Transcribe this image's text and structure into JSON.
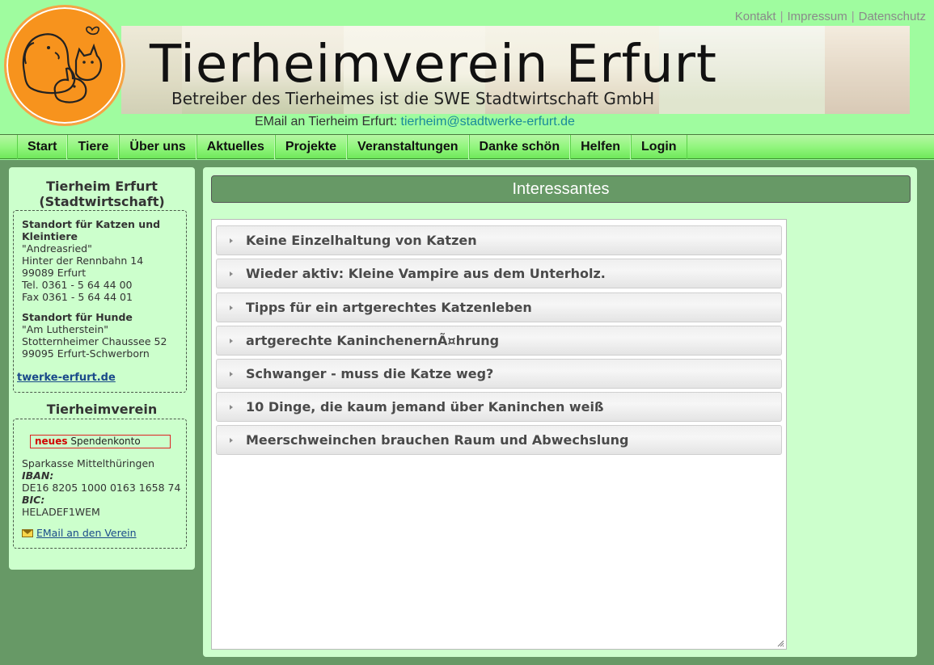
{
  "top_links": [
    "Kontakt",
    "Impressum",
    "Datenschutz"
  ],
  "header": {
    "title": "Tierheimverein Erfurt",
    "subtitle": "Betreiber des Tierheimes ist die SWE Stadtwirtschaft GmbH",
    "email_label": "EMail an Tierheim Erfurt:",
    "email_address": "tierheim@stadtwerke-erfurt.de"
  },
  "nav": [
    "Start",
    "Tiere",
    "Über uns",
    "Aktuelles",
    "Projekte",
    "Veranstaltungen",
    "Danke schön",
    "Helfen",
    "Login"
  ],
  "sidebar": {
    "title1_line1": "Tierheim Erfurt",
    "title1_line2": "(Stadtwirtschaft)",
    "cats_heading": "Standort für Katzen und Kleintiere",
    "cats_lines": [
      "\"Andreasried\"",
      "Hinter der Rennbahn 14",
      "99089 Erfurt",
      "Tel. 0361 - 5 64 44 00",
      "Fax 0361 - 5 64 44 01"
    ],
    "dogs_heading": "Standort für Hunde",
    "dogs_lines": [
      "\"Am Lutherstein\"",
      "Stotternheimer Chaussee 52",
      "99095 Erfurt-Schwerborn"
    ],
    "link_text": "twerke-erfurt.de",
    "title2": "Tierheimverein",
    "donate_new": "neues",
    "donate_label": "Spendenkonto",
    "bank_name": "Sparkasse Mittelthüringen",
    "iban_label": "IBAN:",
    "iban": "DE16 8205 1000 0163 1658 74",
    "bic_label": "BIC:",
    "bic": "HELADEF1WEM",
    "mail_link": "EMail an den Verein"
  },
  "content": {
    "heading": "Interessantes",
    "items": [
      "Keine Einzelhaltung von Katzen",
      "Wieder aktiv: Kleine Vampire aus dem Unterholz.",
      "Tipps für ein artgerechtes Katzenleben",
      "artgerechte KaninchenernÃ¤hrung",
      "Schwanger - muss die Katze weg?",
      "10 Dinge, die kaum jemand über Kaninchen weiß",
      "Meerschweinchen brauchen Raum und Abwechslung"
    ]
  },
  "colors": {
    "page_background": "#9ffc9f",
    "main_green": "#679966",
    "panel_green": "#ccffcc",
    "logo_orange": "#f7931d",
    "link_teal": "#1a8a9a"
  }
}
